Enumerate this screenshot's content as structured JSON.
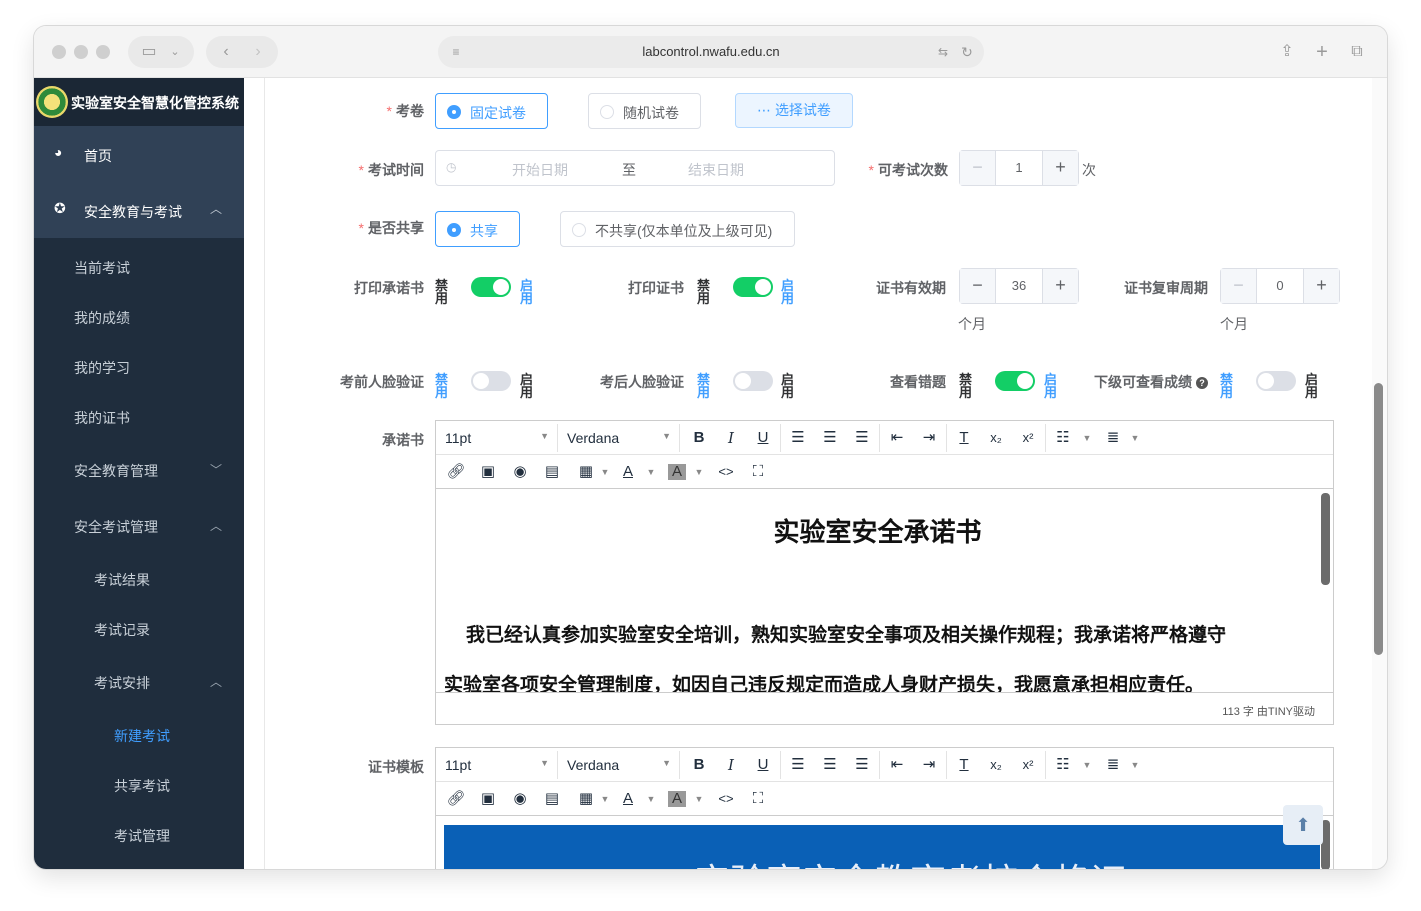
{
  "browser": {
    "url": "labcontrol.nwafu.edu.cn"
  },
  "sidebar": {
    "app_title": "实验室安全智慧化管控系统",
    "items": [
      {
        "label": "首页",
        "icon": "dashboard-icon"
      },
      {
        "label": "安全教育与考试",
        "icon": "lifebuoy-icon"
      },
      {
        "label": "当前考试"
      },
      {
        "label": "我的成绩"
      },
      {
        "label": "我的学习"
      },
      {
        "label": "我的证书"
      },
      {
        "label": "安全教育管理"
      },
      {
        "label": "安全考试管理"
      },
      {
        "label": "考试结果"
      },
      {
        "label": "考试记录"
      },
      {
        "label": "考试安排"
      },
      {
        "label": "新建考试"
      },
      {
        "label": "共享考试"
      },
      {
        "label": "考试管理"
      }
    ]
  },
  "form": {
    "paper": {
      "label": "考卷",
      "options": [
        "固定试卷",
        "随机试卷"
      ],
      "selected": "固定试卷",
      "select_button": "选择试卷"
    },
    "exam_time": {
      "label": "考试时间",
      "start_placeholder": "开始日期",
      "separator": "至",
      "end_placeholder": "结束日期"
    },
    "attempts": {
      "label": "可考试次数",
      "value": "1",
      "unit": "次"
    },
    "share": {
      "label": "是否共享",
      "options": [
        "共享",
        "不共享(仅本单位及上级可见)"
      ],
      "selected": "共享"
    },
    "print_pledge": {
      "label": "打印承诺书",
      "off_text": "禁用",
      "on_text": "启用",
      "enabled": true
    },
    "print_cert": {
      "label": "打印证书",
      "off_text": "禁用",
      "on_text": "启用",
      "enabled": true
    },
    "cert_validity": {
      "label": "证书有效期",
      "value": "36",
      "unit": "个月"
    },
    "cert_review": {
      "label": "证书复审周期",
      "value": "0",
      "unit": "个月"
    },
    "face_before": {
      "label": "考前人脸验证",
      "off_text": "禁用",
      "on_text": "启用",
      "enabled": false
    },
    "face_after": {
      "label": "考后人脸验证",
      "off_text": "禁用",
      "on_text": "启用",
      "enabled": false
    },
    "view_errors": {
      "label": "查看错题",
      "off_text": "禁用",
      "on_text": "启用",
      "enabled": true
    },
    "sub_view_scores": {
      "label": "下级可查看成绩",
      "help": "?",
      "off_text": "禁用",
      "on_text": "启用",
      "enabled": false
    },
    "pledge": {
      "label": "承诺书",
      "font_size": "11pt",
      "font_family": "Verdana",
      "doc_title": "实验室安全承诺书",
      "line1": "我已经认真参加实验室安全培训，熟知实验室安全事项及相关操作规程；我承诺将严格遵守",
      "line2": "实验室各项安全管理制度，如因自己违反规定而造成人身财产损失，我愿意承担相应责任。",
      "status": "113 字 由TINY驱动"
    },
    "cert_template": {
      "label": "证书模板",
      "font_size": "11pt",
      "font_family": "Verdana",
      "banner_text": "实验室安全教育考核合格证"
    }
  },
  "colors": {
    "sidebar_bg": "#1f2d3d",
    "accent": "#409eff",
    "switch_on": "#13ce66",
    "required": "#f56c6c",
    "banner": "#0a60b6"
  }
}
